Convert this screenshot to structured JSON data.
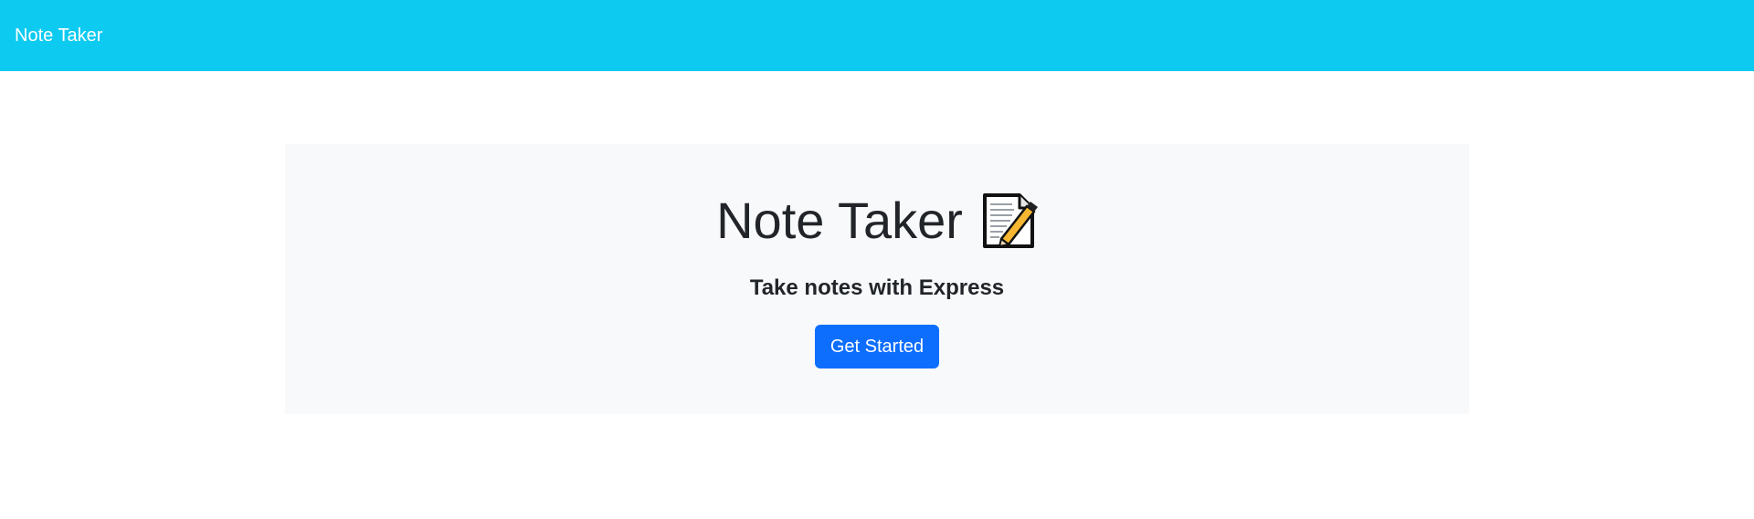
{
  "navbar": {
    "brand": "Note Taker",
    "background_color": "#0dcaf0"
  },
  "hero": {
    "title": "Note Taker",
    "icon": "memo-icon",
    "subtitle": "Take notes with Express",
    "button_label": "Get Started",
    "background_color": "#f8f9fa"
  },
  "colors": {
    "primary": "#0d6efd",
    "text": "#212529"
  }
}
